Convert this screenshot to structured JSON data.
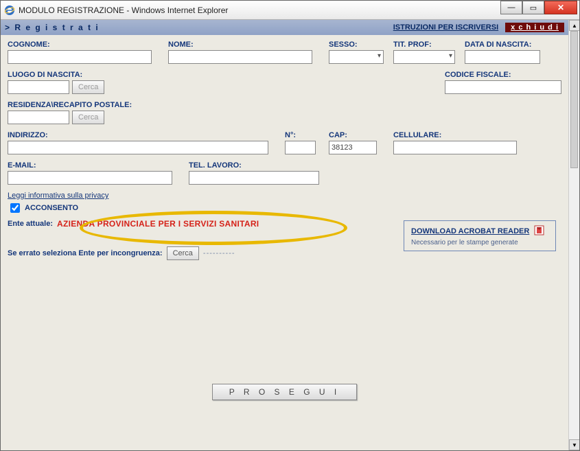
{
  "window": {
    "title": "MODULO REGISTRAZIONE - Windows Internet Explorer"
  },
  "header": {
    "title": "> R e g i s t r a t i",
    "instructions_link": "ISTRUZIONI PER ISCRIVERSI",
    "close_label": "x  c h i u d i"
  },
  "labels": {
    "cognome": "COGNOME:",
    "nome": "NOME:",
    "sesso": "SESSO:",
    "tit_prof": "TIT. PROF:",
    "data_nascita": "DATA DI NASCITA:",
    "luogo_nascita": "LUOGO DI NASCITA:",
    "codice_fiscale": "CODICE FISCALE:",
    "residenza": "RESIDENZA\\RECAPITO POSTALE:",
    "indirizzo": "INDIRIZZO:",
    "numero": "N°:",
    "cap": "CAP:",
    "cellulare": "CELLULARE:",
    "email": "E-MAIL:",
    "tel_lavoro": "TEL. LAVORO:",
    "ente_attuale": "Ente attuale:"
  },
  "values": {
    "cognome": "",
    "nome": "",
    "sesso": "",
    "tit_prof": "",
    "data_nascita": "",
    "luogo_nascita": "",
    "luogo_nascita_desc": "",
    "codice_fiscale": "",
    "residenza": "",
    "residenza_desc": "",
    "indirizzo": "",
    "numero": "",
    "cap": "38123",
    "cellulare": "",
    "email": "",
    "tel_lavoro": "",
    "ente_attuale": "AZIENDA PROVINCIALE PER I SERVIZI SANITARI",
    "ente_incongruenza": "----------"
  },
  "buttons": {
    "cerca": "Cerca",
    "prosegui": "P R O S E G U I"
  },
  "privacy": {
    "link": "Leggi informativa sulla privacy",
    "consent": "ACCONSENTO",
    "consent_checked": true
  },
  "errato_label": "Se errato seleziona Ente per incongruenza:",
  "download_box": {
    "link": "DOWNLOAD ACROBAT READER",
    "sub": "Necessario per le stampe generate"
  }
}
